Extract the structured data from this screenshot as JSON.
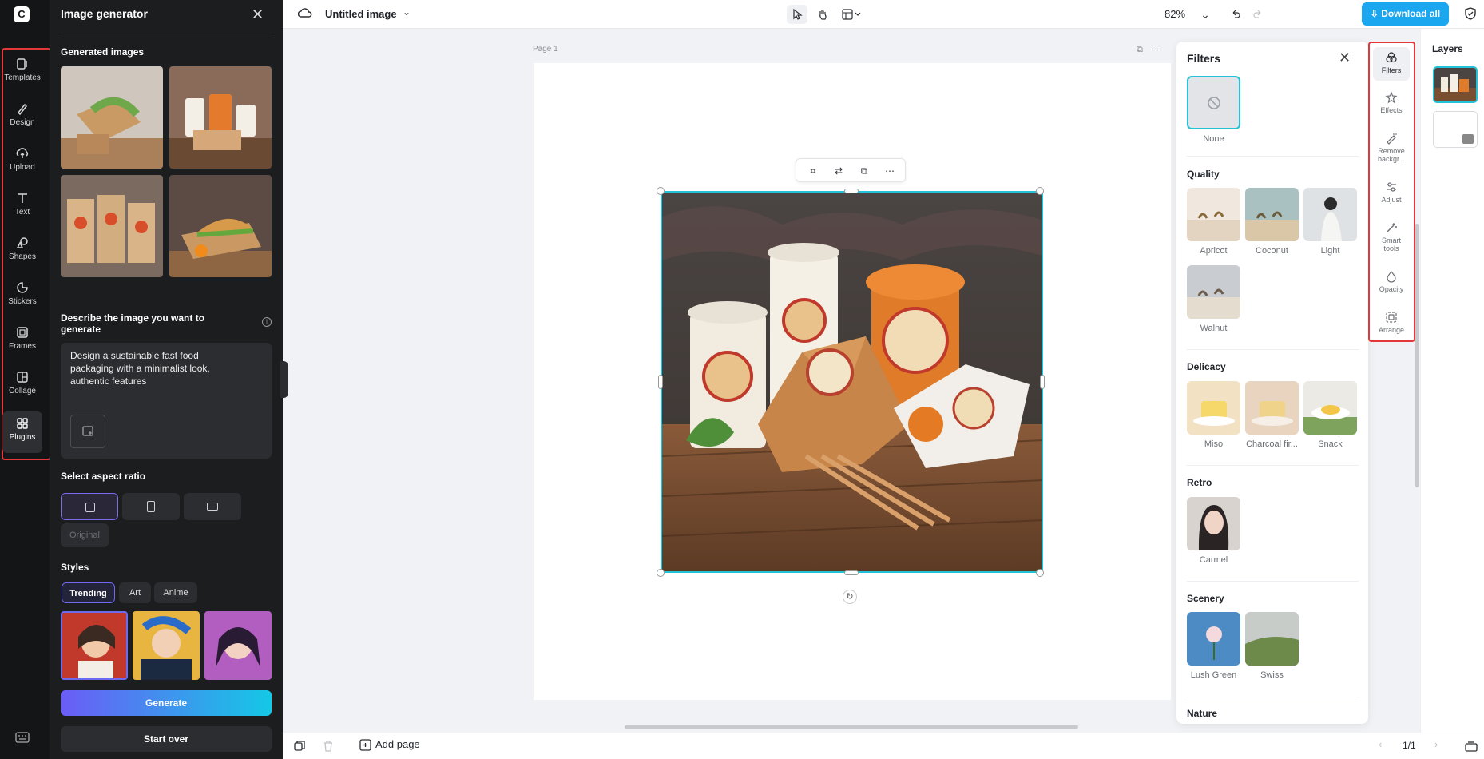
{
  "rail": {
    "items": [
      {
        "label": "Templates",
        "icon": "templates-icon"
      },
      {
        "label": "Design",
        "icon": "design-icon"
      },
      {
        "label": "Upload",
        "icon": "upload-icon"
      },
      {
        "label": "Text",
        "icon": "text-icon"
      },
      {
        "label": "Shapes",
        "icon": "shapes-icon"
      },
      {
        "label": "Stickers",
        "icon": "stickers-icon"
      },
      {
        "label": "Frames",
        "icon": "frames-icon"
      },
      {
        "label": "Collage",
        "icon": "collage-icon"
      },
      {
        "label": "Plugins",
        "icon": "plugins-icon",
        "active": true
      }
    ]
  },
  "generator": {
    "title": "Image generator",
    "generated_heading": "Generated images",
    "describe_heading": "Describe the image you want to generate",
    "prompt": "Design a sustainable fast food packaging with a minimalist look, authentic features",
    "aspect_heading": "Select aspect ratio",
    "aspect_original": "Original",
    "styles_heading": "Styles",
    "style_tabs": [
      "Trending",
      "Art",
      "Anime"
    ],
    "generate_label": "Generate",
    "start_over_label": "Start over"
  },
  "topbar": {
    "doc_title": "Untitled image",
    "zoom": "82%",
    "download_label": "Download all"
  },
  "canvas": {
    "page_label": "Page 1"
  },
  "bottombar": {
    "add_page": "Add page",
    "page_num": "1/1"
  },
  "filters": {
    "title": "Filters",
    "none_label": "None",
    "sections": {
      "quality": {
        "title": "Quality",
        "items": [
          "Apricot",
          "Coconut",
          "Light",
          "Walnut"
        ]
      },
      "delicacy": {
        "title": "Delicacy",
        "items": [
          "Miso",
          "Charcoal fir...",
          "Snack"
        ]
      },
      "retro": {
        "title": "Retro",
        "items": [
          "Carmel"
        ]
      },
      "scenery": {
        "title": "Scenery",
        "items": [
          "Lush Green",
          "Swiss"
        ]
      },
      "nature": {
        "title": "Nature"
      }
    }
  },
  "rtools": {
    "items": [
      "Filters",
      "Effects",
      "Remove backgr...",
      "Adjust",
      "Smart tools",
      "Opacity",
      "Arrange"
    ]
  },
  "layers": {
    "title": "Layers"
  },
  "colors": {
    "accent": "#23c2d8",
    "download": "#1ba6f0",
    "highlight": "#e5383b"
  }
}
